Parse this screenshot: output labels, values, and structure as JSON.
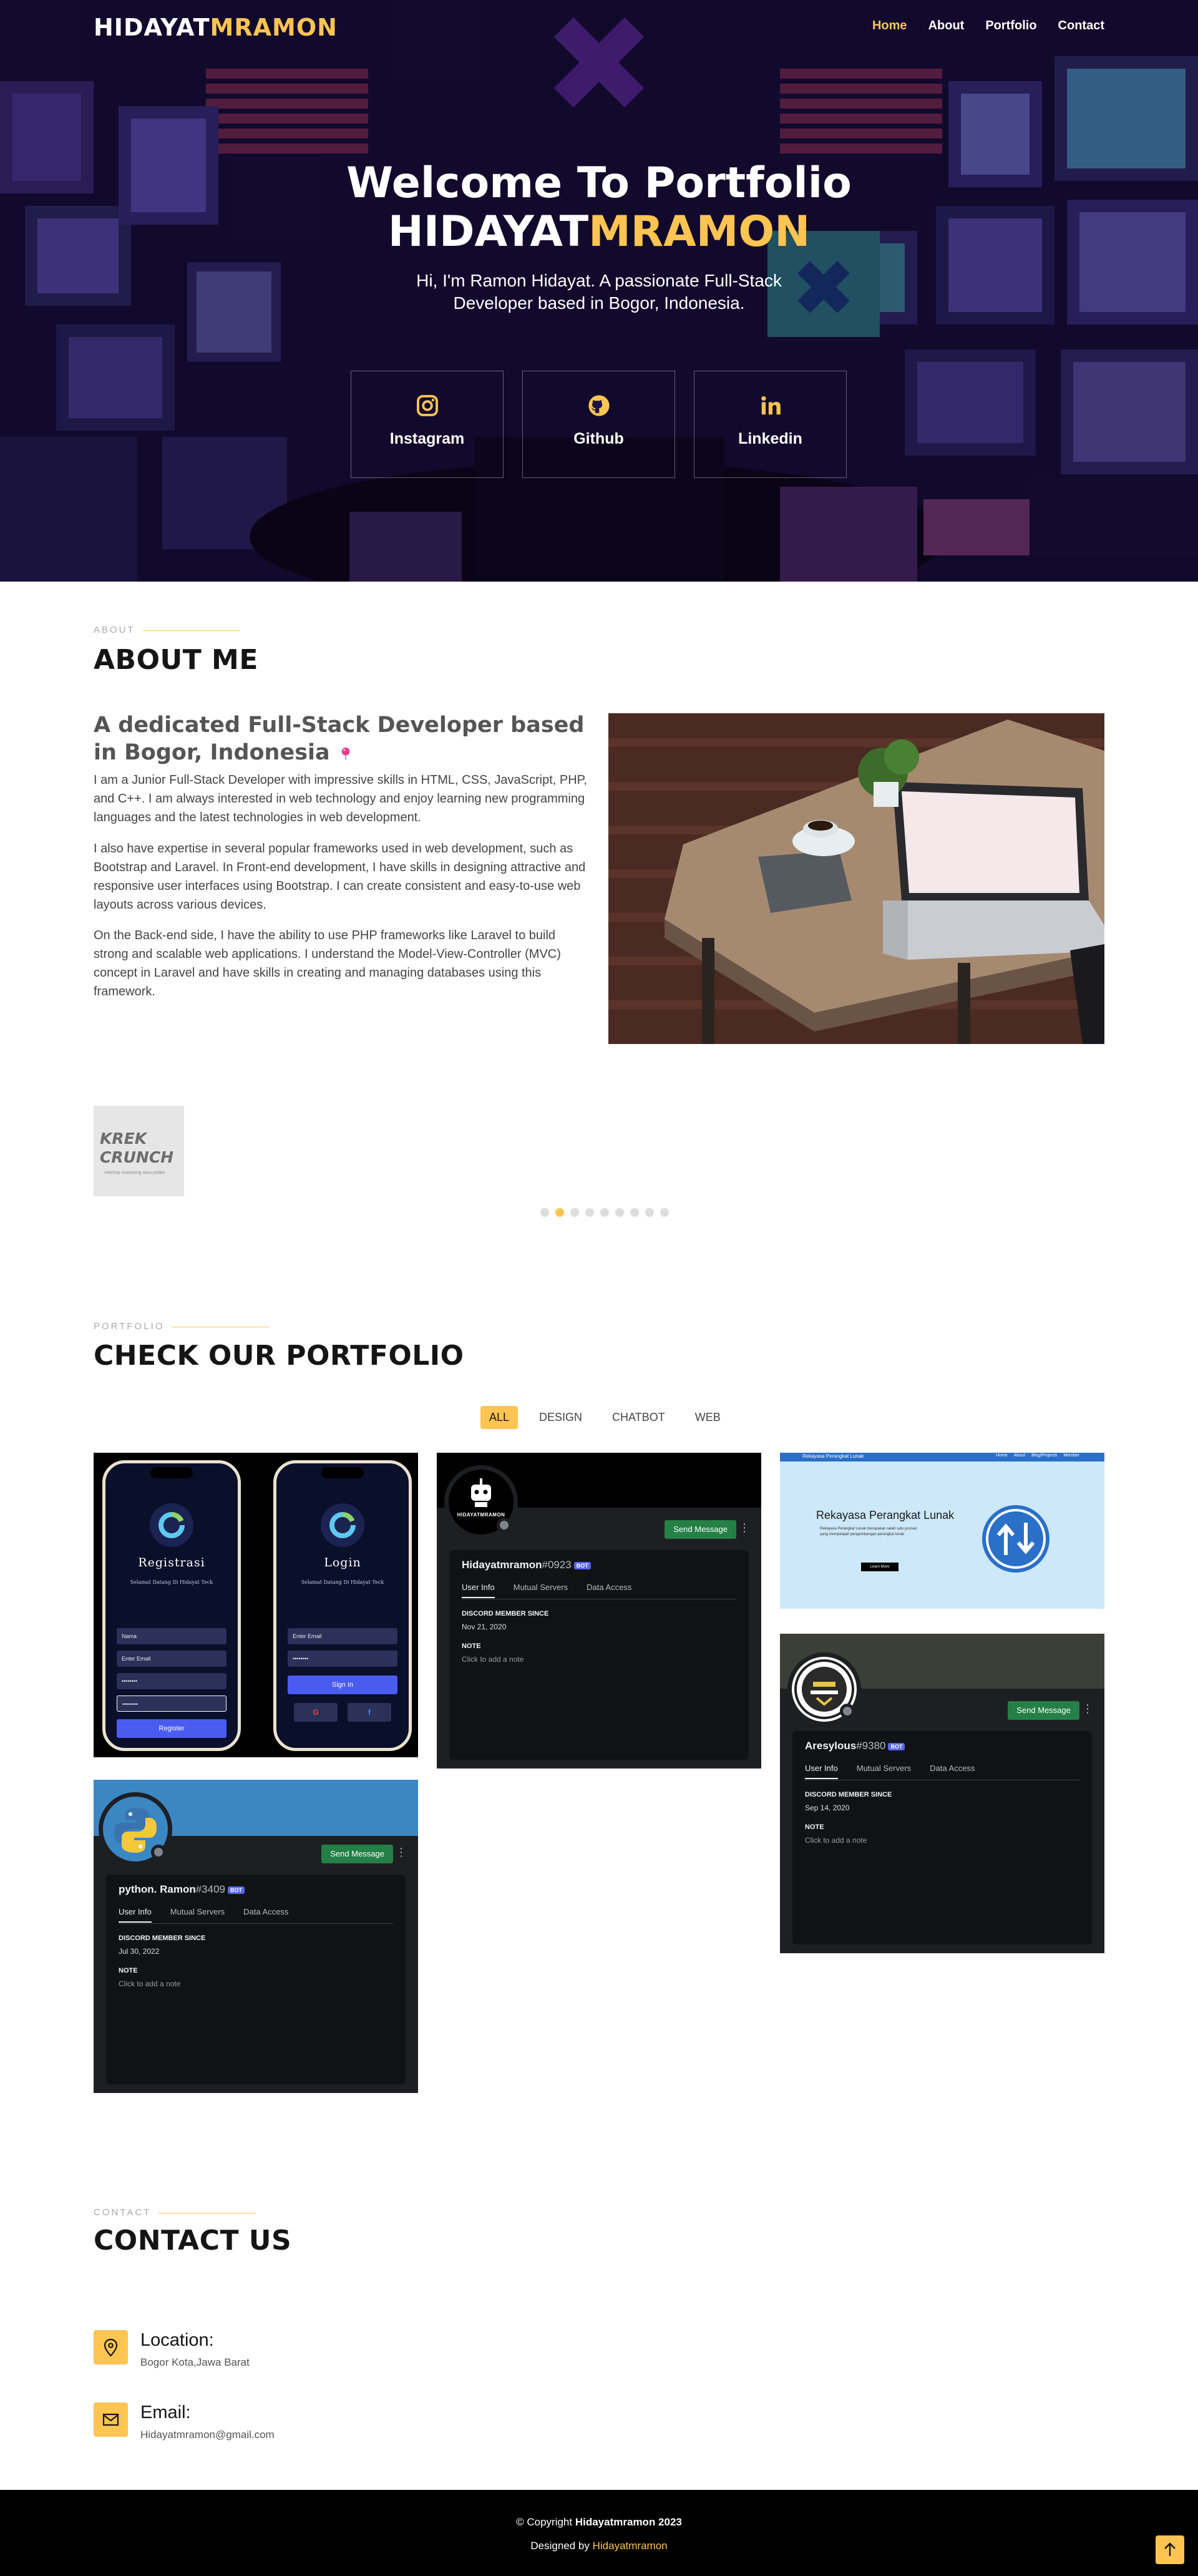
{
  "header": {
    "logo_main": "HIDAYAT",
    "logo_accent": "MRAMON",
    "nav": [
      "Home",
      "About",
      "Portfolio",
      "Contact"
    ]
  },
  "hero": {
    "title_line1": "Welcome To Portfolio",
    "title_main": "HIDAYAT",
    "title_accent": "MRAMON",
    "subtitle": "Hi, I'm Ramon Hidayat. A passionate Full-Stack Developer based in Bogor, Indonesia.",
    "socials": [
      {
        "label": "Instagram",
        "icon": "instagram-icon"
      },
      {
        "label": "Github",
        "icon": "github-icon"
      },
      {
        "label": "Linkedin",
        "icon": "linkedin-icon"
      }
    ]
  },
  "about": {
    "small": "ABOUT",
    "title": "ABOUT ME",
    "heading": "A dedicated Full-Stack Developer based in Bogor, Indonesia",
    "paragraphs": [
      "I am a Junior Full-Stack Developer with impressive skills in HTML, CSS, JavaScript, PHP, and C++. I am always interested in web technology and enjoy learning new programming languages and the latest technologies in web development.",
      "I also have expertise in several popular frameworks used in web development, such as Bootstrap and Laravel. In Front-end development, I have skills in designing attractive and responsive user interfaces using Bootstrap. I can create consistent and easy-to-use web layouts across various devices.",
      "On the Back-end side, I have the ability to use PHP frameworks like Laravel to build strong and scalable web applications. I understand the Model-View-Controller (MVC) concept in Laravel and have skills in creating and managing databases using this framework."
    ]
  },
  "clients": {
    "logo_line1": "KREK",
    "logo_line2": "CRUNCH",
    "logo_tagline": "ketchup seasoning saus pedas",
    "dots_count": 9,
    "active_dot": 2
  },
  "portfolio": {
    "small": "PORTFOLIO",
    "title": "CHECK OUR PORTFOLIO",
    "filters": [
      "ALL",
      "DESIGN",
      "CHATBOT",
      "WEB"
    ],
    "active_filter": "ALL",
    "phone_app": {
      "left_title": "Registrasi",
      "right_title": "Login",
      "welcome": "Selamat Datang Di Hidayat Teck",
      "left_fields": [
        "Nama",
        "Enter Email",
        "••••••••",
        "••••••••"
      ],
      "right_fields": [
        "Enter Email",
        "••••••••"
      ],
      "left_button": "Register",
      "right_button": "Sign In",
      "social_g": "G",
      "social_f": "f"
    },
    "discord_common": {
      "send": "Send Message",
      "tabs": [
        "User Info",
        "Mutual Servers",
        "Data Access"
      ],
      "member_since_label": "DISCORD MEMBER SINCE",
      "note_label": "NOTE",
      "note_placeholder": "Click to add a note",
      "bot": "BOT"
    },
    "discord_cards": [
      {
        "name": "Hidayatmramon",
        "tag": "#0923",
        "since": "Nov 21, 2020",
        "avatar_text": "HIDAYATMRAMON"
      },
      {
        "name": "Aresylous",
        "tag": "#9380",
        "since": "Sep 14, 2020"
      },
      {
        "name": "python. Ramon",
        "tag": "#3409",
        "since": "Jul 30, 2022"
      }
    ],
    "web_card": {
      "nav_brand": "Rekayasa Perangkat Lunak",
      "nav_links": [
        "Home",
        "About",
        "Blog/Projects",
        "Member"
      ],
      "title": "Rekayasa Perangkat Lunak",
      "body": "Rekayasa Perangkat Lunak merupakan salah satu jurusan yang mempelajari pengembangan perangkat lunak",
      "button": "Learn More"
    }
  },
  "contact": {
    "small": "CONTACT",
    "title": "CONTACT US",
    "items": [
      {
        "label": "Location:",
        "value": "Bogor Kota,Jawa Barat",
        "icon": "map-pin-icon"
      },
      {
        "label": "Email:",
        "value": "Hidayatmramon@gmail.com",
        "icon": "envelope-icon"
      }
    ]
  },
  "footer": {
    "copyright_prefix": "© Copyright ",
    "copyright_name": "Hidayatmramon 2023",
    "designed_prefix": "Designed by ",
    "designed_name": "Hidayatmramon"
  },
  "colors": {
    "accent": "#ffc451",
    "dark": "#151515",
    "discord_bg": "#1e1f22",
    "discord_green": "#248046"
  }
}
